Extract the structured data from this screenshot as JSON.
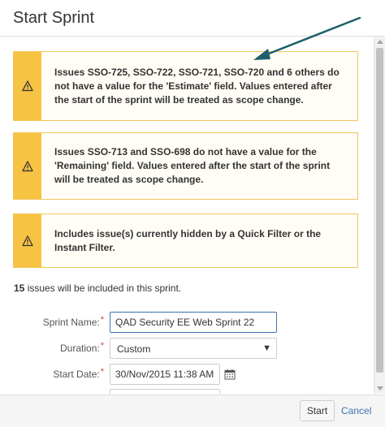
{
  "dialog": {
    "title": "Start Sprint"
  },
  "warnings": [
    {
      "text": "Issues SSO-725, SSO-722, SSO-721, SSO-720 and 6 others do not have a value for the 'Estimate' field. Values entered after the start of the sprint will be treated as scope change."
    },
    {
      "text": "Issues SSO-713 and SSO-698 do not have a value for the 'Remaining' field. Values entered after the start of the sprint will be treated as scope change."
    },
    {
      "text": "Includes issue(s) currently hidden by a Quick Filter or the Instant Filter."
    }
  ],
  "summary": {
    "count": "15",
    "text": " issues will be included in this sprint."
  },
  "form": {
    "required_marker": "*",
    "sprint_name_label": "Sprint Name:",
    "sprint_name_value": "QAD Security EE Web Sprint 22",
    "duration_label": "Duration:",
    "duration_value": "Custom",
    "start_date_label": "Start Date:",
    "start_date_value": "30/Nov/2015 11:38 AM"
  },
  "footer": {
    "start_label": "Start",
    "cancel_label": "Cancel"
  },
  "icons": {
    "warning": "warning-triangle-icon",
    "calendar": "calendar-icon",
    "dropdown": "chevron-down-icon"
  },
  "colors": {
    "warning_accent": "#f6c342",
    "warning_border": "#f0c75a",
    "input_focus": "#3b73af",
    "required": "#d04437",
    "link": "#3b73af",
    "annotation_arrow": "#1e5f6b"
  }
}
